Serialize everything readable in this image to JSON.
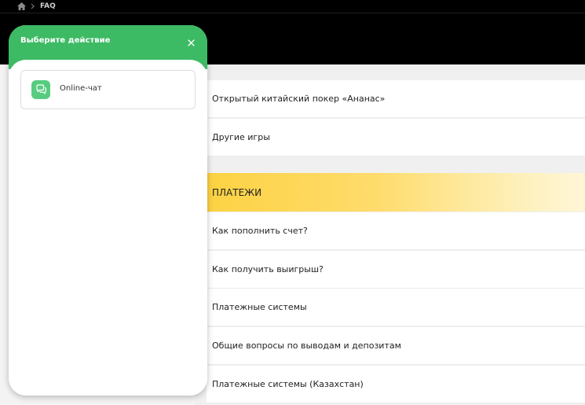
{
  "breadcrumb": {
    "home_icon": "home-icon",
    "separator_icon": "chevron-right-icon",
    "current": "FAQ"
  },
  "panel": {
    "title": "Выберите действие",
    "close_icon": "close-icon",
    "options": [
      {
        "label": "Online-чат",
        "icon": "chat-bubbles-icon"
      }
    ],
    "header_color": "#3dba64",
    "icon_color": "#57cc80"
  },
  "content": {
    "games_items": [
      "Открытый китайский покер «Ананас»",
      "Другие игры"
    ],
    "payments_section": {
      "title": "ПЛАТЕЖИ",
      "accent_color": "#fdd243",
      "items": [
        "Как пополнить счет?",
        "Как получить выигрыш?",
        "Платежные системы",
        "Общие вопросы по выводам и депозитам",
        "Платежные системы (Казахстан)"
      ]
    }
  }
}
